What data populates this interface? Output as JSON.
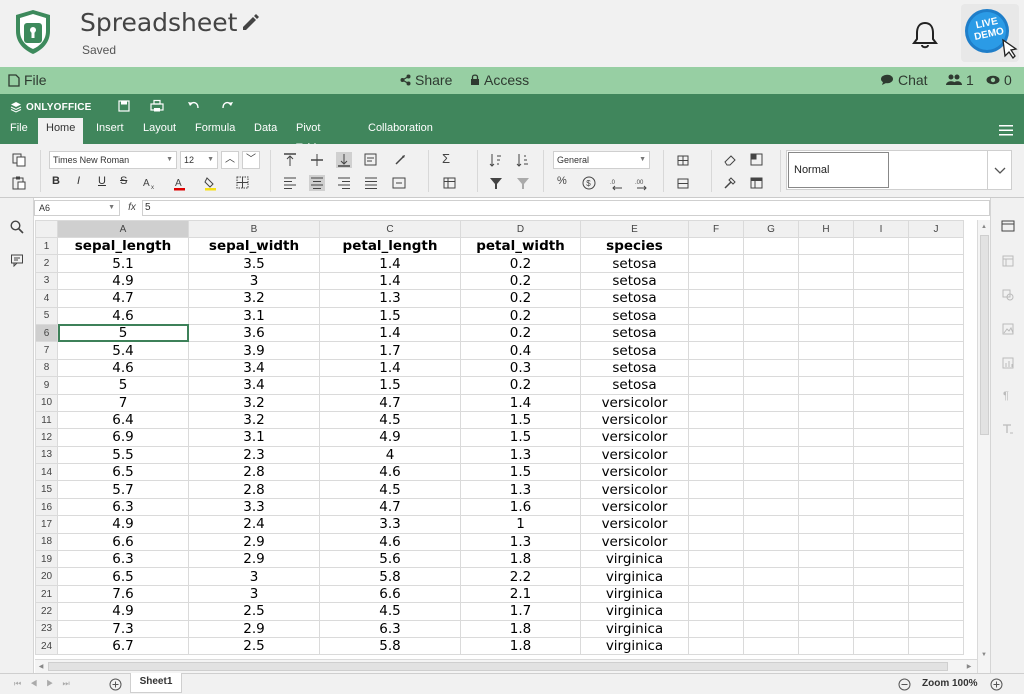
{
  "header": {
    "doc_title": "Spreadsheet",
    "save_status": "Saved",
    "live_demo_line1": "LIVE",
    "live_demo_line2": "DEMO"
  },
  "greenbar": {
    "file_label": "File",
    "share_label": "Share",
    "access_label": "Access",
    "chat_label": "Chat",
    "users_count": "1",
    "views_count": "0"
  },
  "editor": {
    "brand": "ONLYOFFICE",
    "tabs": [
      "File",
      "Home",
      "Insert",
      "Layout",
      "Formula",
      "Data",
      "Pivot Table",
      "Collaboration"
    ],
    "active_tab": "Home"
  },
  "toolbar": {
    "font_name": "Times New Roman",
    "font_size": "12",
    "number_format": "General",
    "cell_style": "Normal",
    "bold_label": "B",
    "italic_label": "I",
    "underline_label": "U",
    "strike_label": "S",
    "percent_label": "%"
  },
  "formula_bar": {
    "cell_ref": "A6",
    "fx_label": "fx",
    "value": "5"
  },
  "sheet": {
    "column_letters": [
      "A",
      "B",
      "C",
      "D",
      "E",
      "F",
      "G",
      "H",
      "I",
      "J"
    ],
    "row_numbers": [
      "1",
      "2",
      "3",
      "4",
      "5",
      "6",
      "7",
      "8",
      "9",
      "10",
      "11",
      "12",
      "13",
      "14",
      "15",
      "16",
      "17",
      "18",
      "19",
      "20",
      "21",
      "22",
      "23",
      "24"
    ],
    "rows": [
      [
        "sepal_length",
        "sepal_width",
        "petal_length",
        "petal_width",
        "species"
      ],
      [
        "5.1",
        "3.5",
        "1.4",
        "0.2",
        "setosa"
      ],
      [
        "4.9",
        "3",
        "1.4",
        "0.2",
        "setosa"
      ],
      [
        "4.7",
        "3.2",
        "1.3",
        "0.2",
        "setosa"
      ],
      [
        "4.6",
        "3.1",
        "1.5",
        "0.2",
        "setosa"
      ],
      [
        "5",
        "3.6",
        "1.4",
        "0.2",
        "setosa"
      ],
      [
        "5.4",
        "3.9",
        "1.7",
        "0.4",
        "setosa"
      ],
      [
        "4.6",
        "3.4",
        "1.4",
        "0.3",
        "setosa"
      ],
      [
        "5",
        "3.4",
        "1.5",
        "0.2",
        "setosa"
      ],
      [
        "7",
        "3.2",
        "4.7",
        "1.4",
        "versicolor"
      ],
      [
        "6.4",
        "3.2",
        "4.5",
        "1.5",
        "versicolor"
      ],
      [
        "6.9",
        "3.1",
        "4.9",
        "1.5",
        "versicolor"
      ],
      [
        "5.5",
        "2.3",
        "4",
        "1.3",
        "versicolor"
      ],
      [
        "6.5",
        "2.8",
        "4.6",
        "1.5",
        "versicolor"
      ],
      [
        "5.7",
        "2.8",
        "4.5",
        "1.3",
        "versicolor"
      ],
      [
        "6.3",
        "3.3",
        "4.7",
        "1.6",
        "versicolor"
      ],
      [
        "4.9",
        "2.4",
        "3.3",
        "1",
        "versicolor"
      ],
      [
        "6.6",
        "2.9",
        "4.6",
        "1.3",
        "versicolor"
      ],
      [
        "6.3",
        "2.9",
        "5.6",
        "1.8",
        "virginica"
      ],
      [
        "6.5",
        "3",
        "5.8",
        "2.2",
        "virginica"
      ],
      [
        "7.6",
        "3",
        "6.6",
        "2.1",
        "virginica"
      ],
      [
        "4.9",
        "2.5",
        "4.5",
        "1.7",
        "virginica"
      ],
      [
        "7.3",
        "2.9",
        "6.3",
        "1.8",
        "virginica"
      ],
      [
        "6.7",
        "2.5",
        "5.8",
        "1.8",
        "virginica"
      ]
    ],
    "selected_row": 6,
    "selected_col": "A"
  },
  "statusbar": {
    "sheet_name": "Sheet1",
    "zoom_label": "Zoom 100%"
  },
  "colors": {
    "header_bg": "#f1f1f1",
    "light_green": "#97cfa3",
    "dark_green": "#40865c",
    "selection": "#3d8159"
  }
}
